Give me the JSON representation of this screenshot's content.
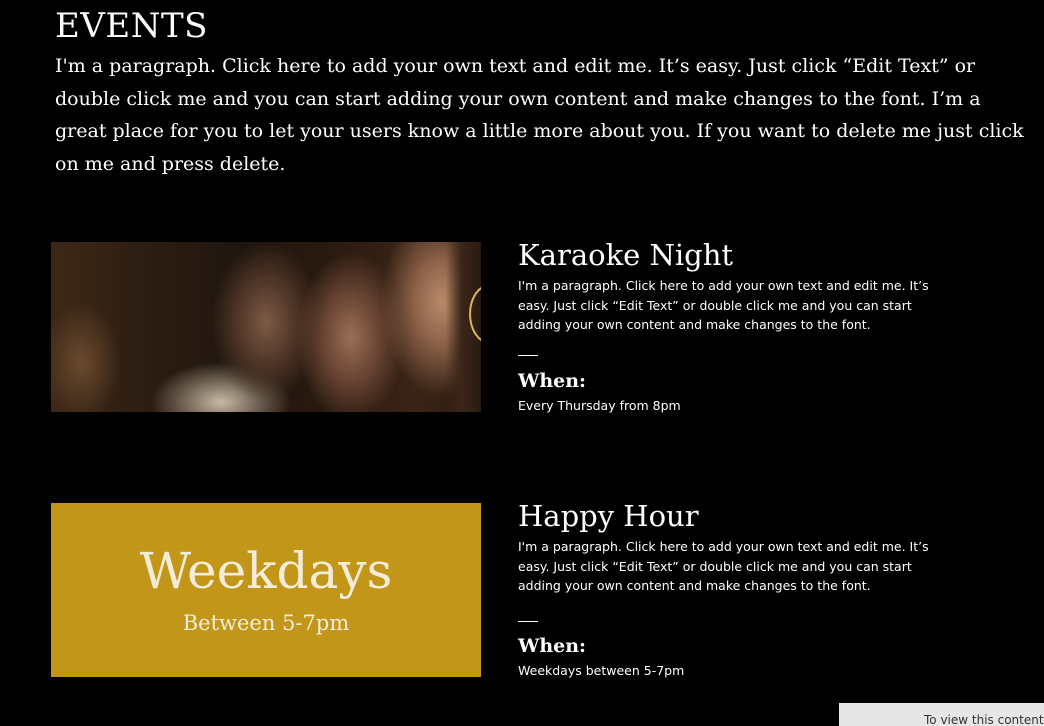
{
  "header": {
    "title": "EVENTS",
    "intro": "I'm a paragraph. Click here to add your own text and edit me. It’s easy. Just click “Edit Text” or double click me and you can start adding your own content and make changes to the font. I’m a great place for you to let your users know a little more about you. If you want to delete me just click on me and press delete."
  },
  "events": [
    {
      "title": "Karaoke Night",
      "description": "I'm a paragraph. Click here to add your own text and edit me. It’s easy. Just click “Edit Text” or double click me and you can start adding your own content and make changes to the font.",
      "when_label": "When:",
      "when_value": "Every Thursday from 8pm",
      "image": "karaoke-photo"
    },
    {
      "title": "Happy Hour",
      "description": "I'm a paragraph. Click here to add your own text and edit me. It’s easy. Just click “Edit Text” or double click me and you can start adding your own content and make changes to the font.",
      "when_label": "When:",
      "when_value": "Weekdays between 5-7pm",
      "image_text_big": "Weekdays",
      "image_text_small": "Between 5-7pm",
      "image_color": "#c29618"
    }
  ],
  "notice": {
    "text": "To view this content"
  },
  "colors": {
    "background": "#000000",
    "text": "#ffffff",
    "accent_gold": "#c29618"
  }
}
